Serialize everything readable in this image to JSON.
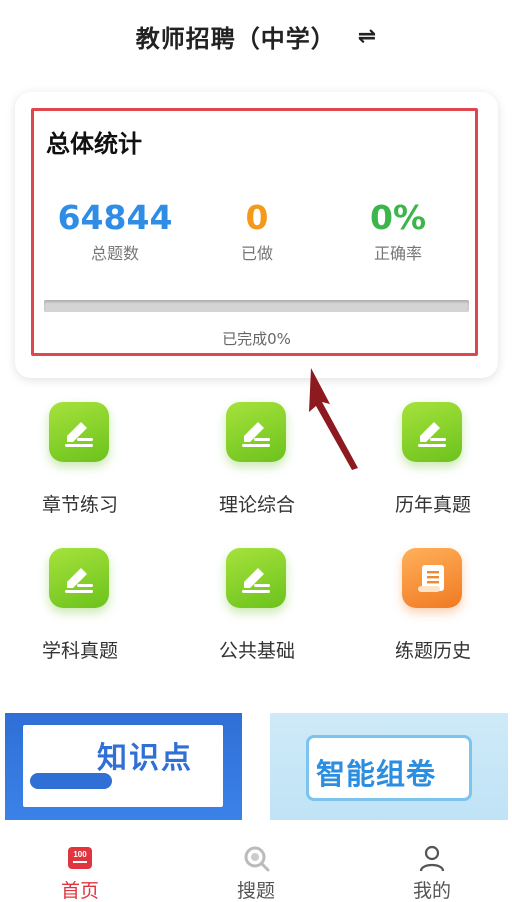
{
  "header": {
    "title": "教师招聘（中学）",
    "switch_icon": "⇌"
  },
  "stats": {
    "title": "总体统计",
    "total_value": "64844",
    "total_label": "总题数",
    "done_value": "0",
    "done_label": "已做",
    "rate_value": "0%",
    "rate_label": "正确率",
    "progress": 0,
    "progress_text": "已完成0%"
  },
  "menu": [
    {
      "label": "章节练习",
      "icon": "edit-icon"
    },
    {
      "label": "理论综合",
      "icon": "edit-icon"
    },
    {
      "label": "历年真题",
      "icon": "edit-icon"
    },
    {
      "label": "学科真题",
      "icon": "edit-icon"
    },
    {
      "label": "公共基础",
      "icon": "edit-icon"
    },
    {
      "label": "练题历史",
      "icon": "scroll-icon"
    }
  ],
  "banners": [
    {
      "text": "知识点"
    },
    {
      "text": "智能组卷"
    }
  ],
  "tabs": [
    {
      "label": "首页",
      "icon": "home-100-icon",
      "badge": "100"
    },
    {
      "label": "搜题",
      "icon": "search-question-icon"
    },
    {
      "label": "我的",
      "icon": "user-icon"
    }
  ],
  "colors": {
    "accent": "#e0353e",
    "blue": "#2f8de6",
    "orange": "#f39a1b",
    "green": "#3cb64a"
  }
}
